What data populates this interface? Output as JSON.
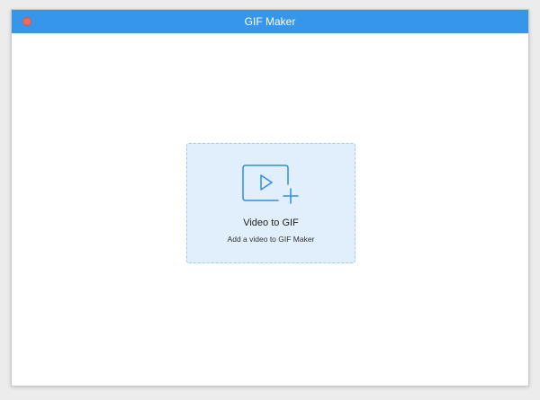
{
  "window": {
    "title": "GIF Maker"
  },
  "drop_zone": {
    "title": "Video to GIF",
    "subtitle": "Add a video to GIF Maker",
    "icon": "add-video-icon"
  },
  "colors": {
    "titlebar": "#3596ea",
    "close_button": "#ec6a5e",
    "drop_zone_bg": "#e1eefc",
    "drop_zone_border": "#9ccaf2",
    "icon_stroke": "#2f8ee0"
  }
}
